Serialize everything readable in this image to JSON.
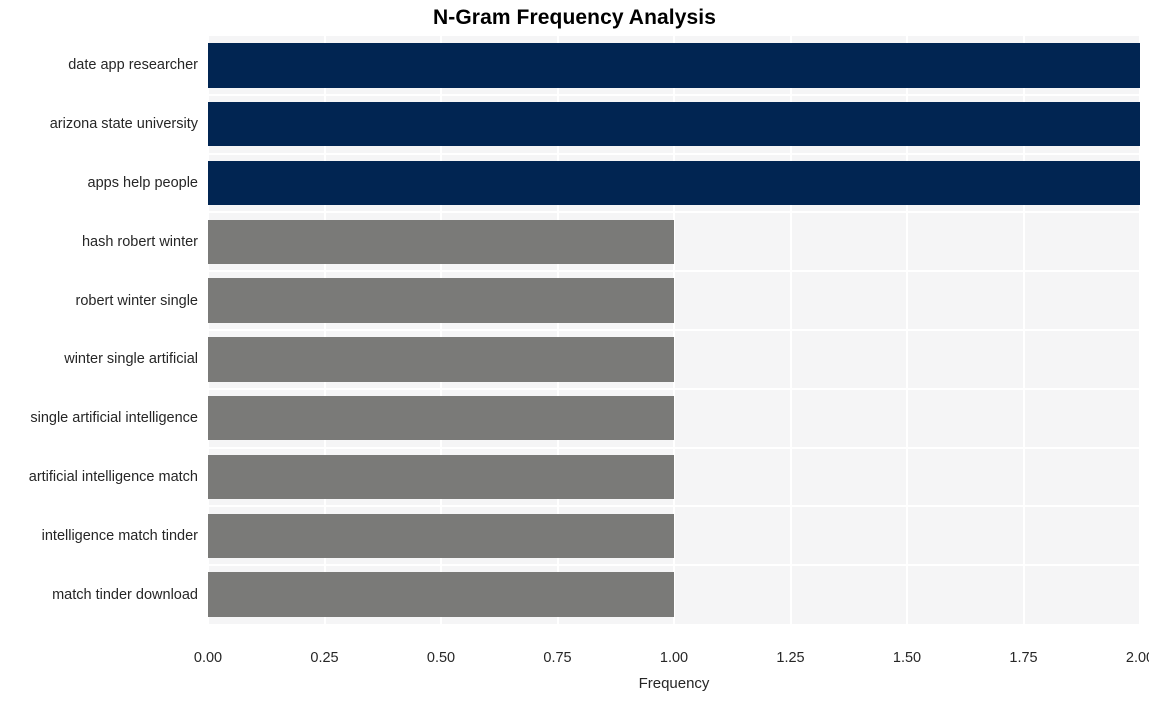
{
  "chart_data": {
    "type": "bar",
    "orientation": "horizontal",
    "title": "N-Gram Frequency Analysis",
    "xlabel": "Frequency",
    "ylabel": "",
    "categories": [
      "date app researcher",
      "arizona state university",
      "apps help people",
      "hash robert winter",
      "robert winter single",
      "winter single artificial",
      "single artificial intelligence",
      "artificial intelligence match",
      "intelligence match tinder",
      "match tinder download"
    ],
    "values": [
      2,
      2,
      2,
      1,
      1,
      1,
      1,
      1,
      1,
      1
    ],
    "bar_colors": [
      "#012552",
      "#012552",
      "#012552",
      "#7a7a78",
      "#7a7a78",
      "#7a7a78",
      "#7a7a78",
      "#7a7a78",
      "#7a7a78",
      "#7a7a78"
    ],
    "xlim": [
      0,
      2
    ],
    "xticks": [
      0,
      0.25,
      0.5,
      0.75,
      1.0,
      1.25,
      1.5,
      1.75,
      2.0
    ],
    "xtick_labels": [
      "0.00",
      "0.25",
      "0.50",
      "0.75",
      "1.00",
      "1.25",
      "1.50",
      "1.75",
      "2.00"
    ],
    "grid": true,
    "grid_color": "#ffffff",
    "plot_background": "#f5f5f6",
    "figure_background": "#ffffff",
    "legend": null,
    "annotations": []
  },
  "colors": {
    "accent_primary": "#012552",
    "accent_secondary": "#7a7a78",
    "text": "#262626",
    "title": "#000000"
  }
}
